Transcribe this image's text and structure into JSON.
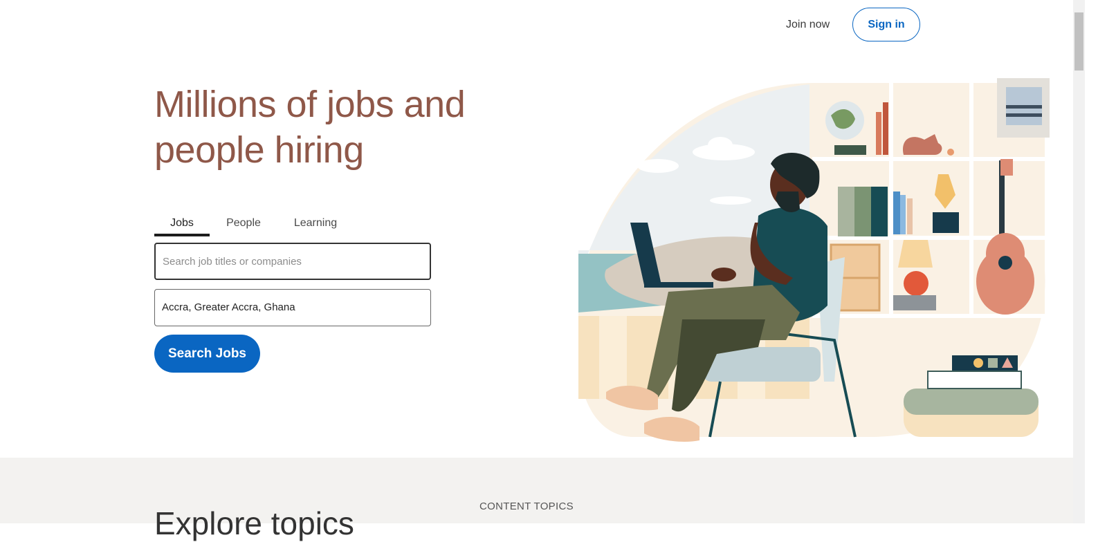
{
  "nav": {
    "join_label": "Join now",
    "signin_label": "Sign in"
  },
  "hero": {
    "title_line1": "Millions of jobs and",
    "title_line2": "people hiring"
  },
  "tabs": [
    {
      "label": "Jobs",
      "active": true
    },
    {
      "label": "People",
      "active": false
    },
    {
      "label": "Learning",
      "active": false
    }
  ],
  "search": {
    "keyword_placeholder": "Search job titles or companies",
    "keyword_value": "",
    "location_value": "Accra, Greater Accra, Ghana",
    "button_label": "Search Jobs"
  },
  "bottom": {
    "heading": "Explore topics",
    "content_topics_label": "CONTENT TOPICS"
  },
  "colors": {
    "brand": "#0a66c2",
    "hero_title": "#8f5849",
    "bottom_bg": "#f3f2f0"
  }
}
